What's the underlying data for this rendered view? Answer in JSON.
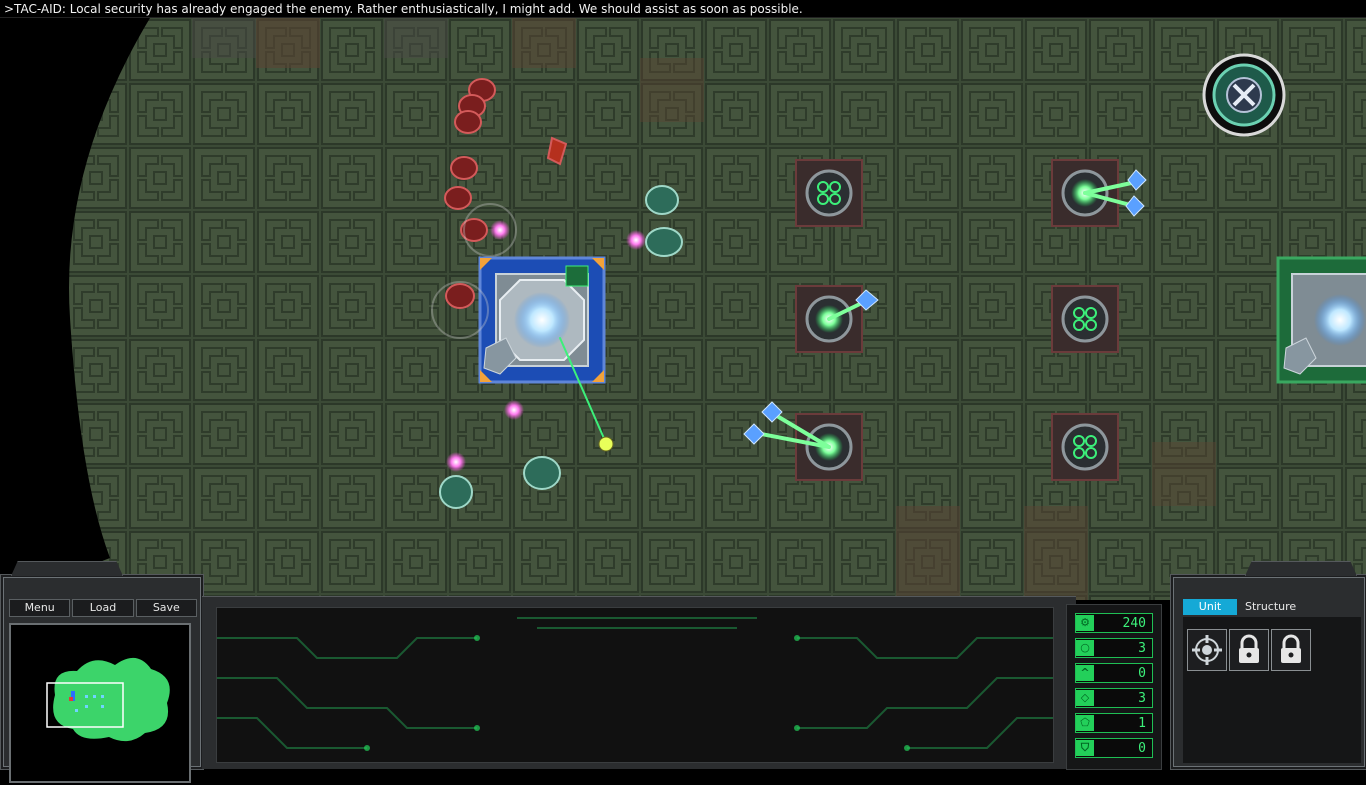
{
  "message": {
    "text": ">TAC-AID: Local security has already engaged the enemy. Rather enthusiastically, I might add. We should assist as soon as possible."
  },
  "menu": {
    "menu_label": "Menu",
    "load_label": "Load",
    "save_label": "Save"
  },
  "resources": [
    {
      "icon": "chip-icon",
      "symbol": "⚙",
      "value": "240"
    },
    {
      "icon": "circle-icon",
      "symbol": "○",
      "value": "3"
    },
    {
      "icon": "chevron-up-icon",
      "symbol": "^",
      "value": "0"
    },
    {
      "icon": "diamond-icon",
      "symbol": "◇",
      "value": "3"
    },
    {
      "icon": "pentagon-icon",
      "symbol": "⬠",
      "value": "1"
    },
    {
      "icon": "shield-icon",
      "symbol": "⛉",
      "value": "0"
    }
  ],
  "build_panel": {
    "tab_unit": "Unit",
    "tab_structure": "Structure",
    "active_tab": "Unit",
    "items": [
      {
        "icon": "drone-build-icon",
        "locked": false
      },
      {
        "icon": "lock-icon",
        "locked": true
      },
      {
        "icon": "lock-icon",
        "locked": true
      }
    ]
  },
  "colors": {
    "friendly_beam": "#3cf07a",
    "enemy_plasma": "#ff4fe0",
    "hud_accent": "#23d05a",
    "tab_active": "#15a9d6"
  }
}
